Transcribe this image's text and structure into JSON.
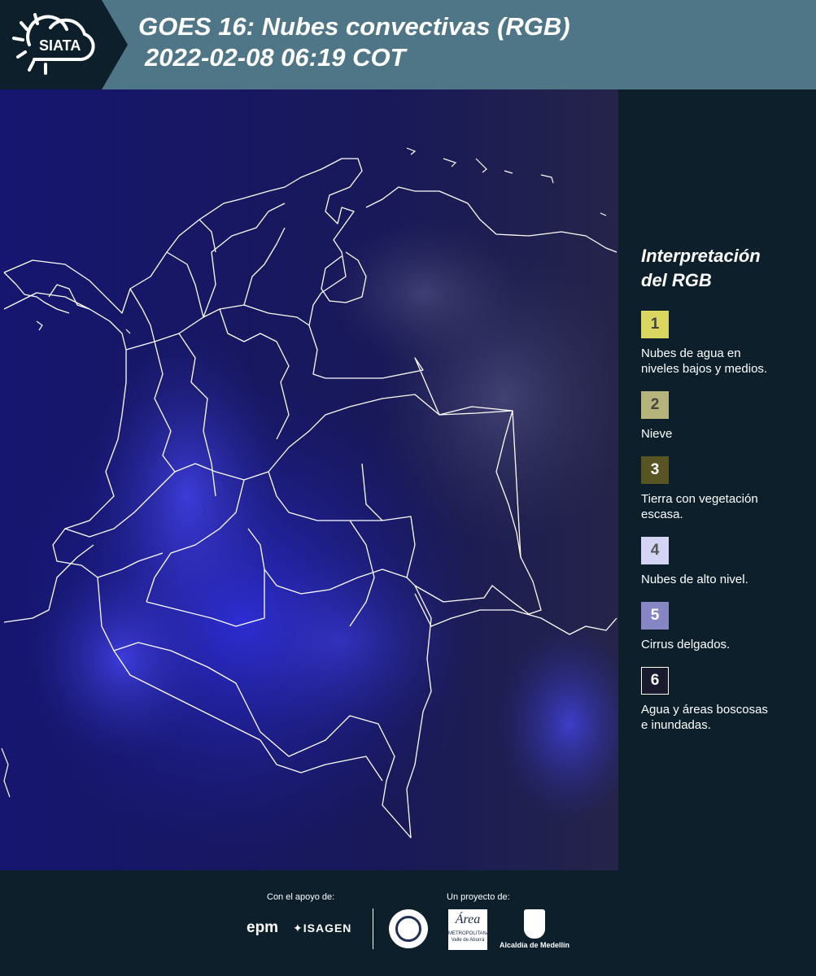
{
  "header": {
    "brand": "SIATA",
    "title_line1": "GOES 16: Nubes convectivas (RGB)",
    "title_line2": "2022-02-08 06:19 COT"
  },
  "legend": {
    "title_line1": "Interpretación",
    "title_line2": "del RGB",
    "items": [
      {
        "number": "1",
        "label_line1": "Nubes de agua en",
        "label_line2": "niveles bajos y medios.",
        "color": "#d9d760",
        "text_color": "#444444"
      },
      {
        "number": "2",
        "label_line1": "Nieve",
        "label_line2": "",
        "color": "#b5b47a",
        "text_color": "#444444"
      },
      {
        "number": "3",
        "label_line1": "Tierra con vegetación",
        "label_line2": "escasa.",
        "color": "#565523",
        "text_color": "#ffffff"
      },
      {
        "number": "4",
        "label_line1": "Nubes de alto nivel.",
        "label_line2": "",
        "color": "#d4d4f4",
        "text_color": "#555555"
      },
      {
        "number": "5",
        "label_line1": "Cirrus delgados.",
        "label_line2": "",
        "color": "#8686c4",
        "text_color": "#ffffff"
      },
      {
        "number": "6",
        "label_line1": "Agua y áreas boscosas",
        "label_line2": "e inundadas.",
        "color": "#1a1a2e",
        "text_color": "#ffffff"
      }
    ]
  },
  "footer": {
    "support_caption": "Con el apoyo de:",
    "project_caption": "Un proyecto de:",
    "epm": "epm",
    "isagen": "ISAGEN",
    "area_line1": "METROPOLITANA",
    "area_line2": "Valle de Aburrá",
    "alcaldia": "Alcaldía de Medellín",
    "area_script": "Área"
  },
  "colors": {
    "header_bg": "#4f7686",
    "panel_bg": "#0c1f2b",
    "map_bg": "#141654",
    "accent_blue": "#3a3aff"
  }
}
